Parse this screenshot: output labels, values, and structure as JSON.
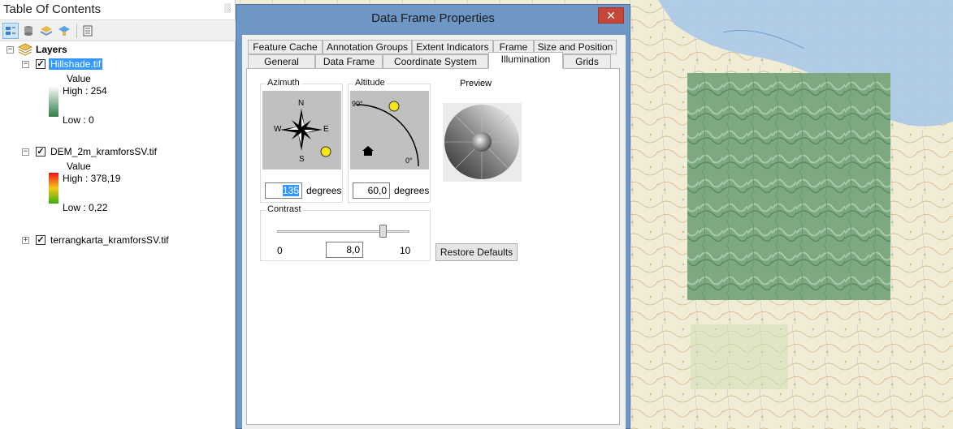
{
  "toc": {
    "title": "Table Of Contents",
    "pin_glyph": "░",
    "toolbar": {
      "icons": [
        "list-by-drawing-order-icon",
        "list-by-source-icon",
        "list-by-visibility-icon",
        "list-by-selection-icon",
        "options-icon"
      ]
    },
    "root": {
      "label": "Layers",
      "expanded": "−"
    },
    "layers": [
      {
        "name": "Hillshade.tif",
        "expander": "−",
        "checked": "✓",
        "legend_title": "Value",
        "high": "High : 254",
        "low": "Low : 0",
        "ramp_colors": [
          "#ffffff",
          "#2e7d45"
        ]
      },
      {
        "name": "DEM_2m_kramforsSV.tif",
        "expander": "−",
        "checked": "✓",
        "legend_title": "Value",
        "high": "High : 378,19",
        "low": "Low : 0,22",
        "ramp_colors": [
          "#e8121a",
          "#f7c81b",
          "#34b10c"
        ]
      },
      {
        "name": "terrangkarta_kramforsSV.tif",
        "expander": "+",
        "checked": "✓"
      }
    ]
  },
  "dialog": {
    "title": "Data Frame Properties",
    "close_glyph": "✕",
    "tabs_row1": [
      "Feature Cache",
      "Annotation Groups",
      "Extent Indicators",
      "Frame",
      "Size and Position"
    ],
    "tabs_row2": [
      "General",
      "Data Frame",
      "Coordinate System",
      "Illumination",
      "Grids"
    ],
    "active_tab": "Illumination",
    "azimuth": {
      "label": "Azimuth",
      "value": "135",
      "unit": "degrees",
      "compass": {
        "n": "N",
        "s": "S",
        "e": "E",
        "w": "W"
      }
    },
    "altitude": {
      "label": "Altitude",
      "value": "60,0",
      "unit": "degrees",
      "top_mark": "90°",
      "bottom_mark": "0°"
    },
    "preview": {
      "label": "Preview"
    },
    "contrast": {
      "label": "Contrast",
      "min": "0",
      "max": "10",
      "value": "8,0",
      "level": 0.8
    },
    "restore_defaults": "Restore Defaults"
  }
}
